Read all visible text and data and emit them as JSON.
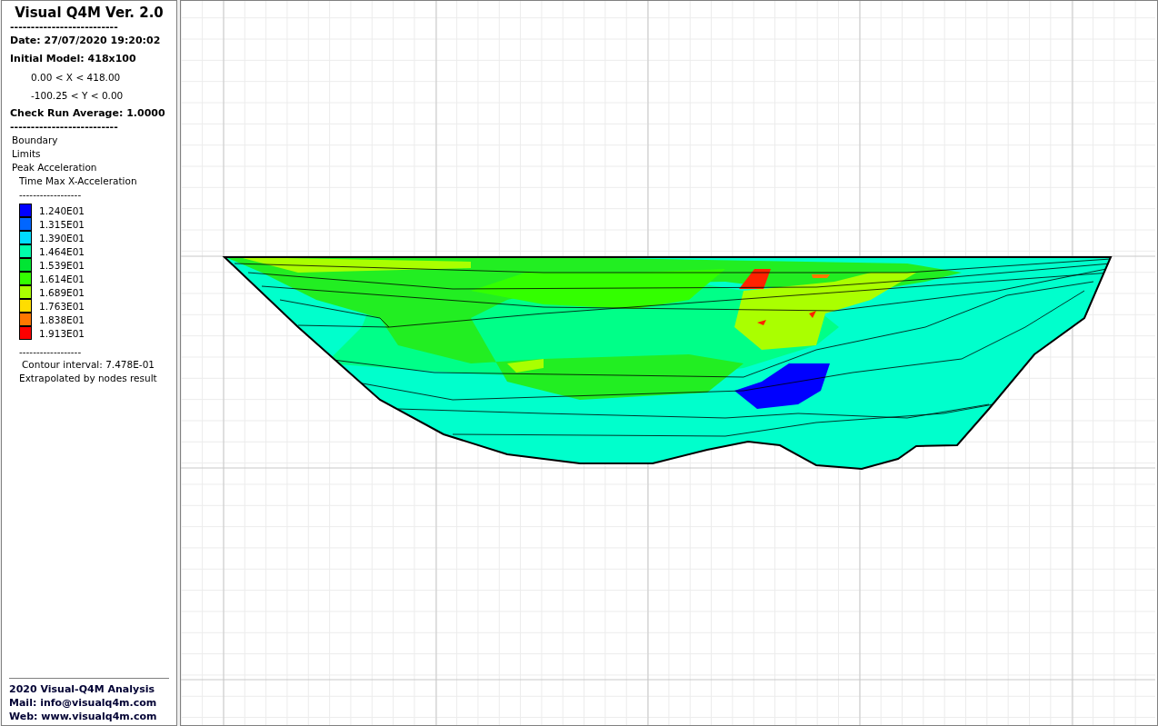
{
  "panel": {
    "title": "Visual Q4M Ver. 2.0",
    "info": [
      {
        "kind": "rule",
        "text": "--------------------------"
      },
      {
        "kind": "bold",
        "text": "Date: 27/07/2020 19:20:02"
      },
      {
        "kind": "bold",
        "text": "Initial Model: 418x100"
      },
      {
        "kind": "range",
        "text": "0.00 < X < 418.00"
      },
      {
        "kind": "range",
        "text": "-100.25 < Y < 0.00"
      },
      {
        "kind": "bold",
        "text": "Check Run Average: 1.0000"
      },
      {
        "kind": "rule",
        "text": "--------------------------"
      }
    ],
    "layers": [
      {
        "label": "Boundary"
      },
      {
        "label": "Limits"
      },
      {
        "label": "Peak Acceleration",
        "children": [
          {
            "label": "Time Max X-Acceleration"
          }
        ]
      }
    ],
    "legend_separator_top": "------------------",
    "legend": [
      {
        "color": "#0000ff",
        "value": "1.240E01"
      },
      {
        "color": "#0066ff",
        "value": "1.315E01"
      },
      {
        "color": "#00ddff",
        "value": "1.390E01"
      },
      {
        "color": "#00ffaa",
        "value": "1.464E01"
      },
      {
        "color": "#00e533",
        "value": "1.539E01"
      },
      {
        "color": "#33ff00",
        "value": "1.614E01"
      },
      {
        "color": "#aaff00",
        "value": "1.689E01"
      },
      {
        "color": "#ffdd00",
        "value": "1.763E01"
      },
      {
        "color": "#ff7700",
        "value": "1.838E01"
      },
      {
        "color": "#ff0000",
        "value": "1.913E01"
      }
    ],
    "legend_separator_bottom": "------------------",
    "contour_interval": "Contour interval: 7.478E-01",
    "note": "Extrapolated by nodes result",
    "footer": [
      "2020 Visual-Q4M Analysis",
      "Mail: info@visualq4m.com",
      "Web: www.visualq4m.com"
    ]
  }
}
